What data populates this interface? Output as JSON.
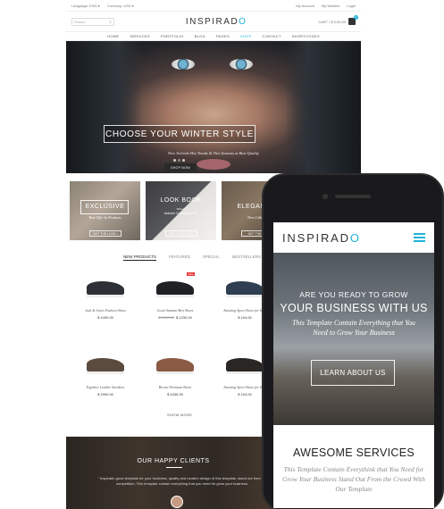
{
  "desktop": {
    "topbar": {
      "language": "Language: ENG ▾",
      "currency": "Currency: USD ▾",
      "my_account": "My Account",
      "wishlist": "My Wishlist",
      "login": "Login"
    },
    "header": {
      "search_placeholder": "Search",
      "logo_main": "INSPIRAD",
      "logo_o": "O",
      "cart_label": "CART / $ 0,00.00",
      "cart_count": "0"
    },
    "nav": [
      "HOME",
      "SERVICES",
      "PORTFOLIO",
      "BLOG",
      "PAGES",
      "SHOP",
      "CONTACT",
      "SHORTCODES"
    ],
    "nav_active": "SHOP",
    "hero": {
      "title": "CHOOSE YOUR WINTER STYLE",
      "subtitle": "New Arrivals Hot Trends & This Seasons at Best Quality",
      "button": "SHOP NOW"
    },
    "banners": [
      {
        "title": "EXCLUSIVE",
        "subtitle": "Best Offer In Products",
        "button": "GET THE LOOK ›"
      },
      {
        "title": "LOOK BOOK",
        "subtitle": "Woman",
        "extra": "Autumn Collection 2015",
        "button": "GET THE LOOK ›"
      },
      {
        "title": "ELEGANT C",
        "subtitle": "New Collecti",
        "button": "GET THE LO"
      }
    ],
    "tabs": [
      "NEW PRODUCTS",
      "FEATURED",
      "SPECIAL",
      "BESTSELLERS"
    ],
    "active_tab": "NEW PRODUCTS",
    "products": [
      {
        "name": "Jack & Jones Fashion Shoes",
        "price": "$ 1090.00",
        "old": "",
        "sale": "",
        "color": "#2d3036"
      },
      {
        "name": "Good Autumn Men Shoes",
        "price": "$ 1230.00",
        "old": "$ 2300.00",
        "sale": "Sale",
        "color": "#1f2125"
      },
      {
        "name": "Amazing Sport Shoes for Men",
        "price": "$ 104.00",
        "old": "",
        "sale": "",
        "color": "#2f3e52"
      },
      {
        "name": "Elegant Sport Sh",
        "price": "$ 1",
        "old": "",
        "sale": "",
        "color": "#5a4a3a"
      },
      {
        "name": "Together Leather Sneakers",
        "price": "$ 1990.00",
        "old": "",
        "sale": "",
        "color": "#5b4a3e"
      },
      {
        "name": "Brown Premium Shoes",
        "price": "$ 4435.00",
        "old": "",
        "sale": "",
        "color": "#8a5a44"
      },
      {
        "name": "Amazing Sport Shoes for Men",
        "price": "$ 104.00",
        "old": "",
        "sale": "",
        "color": "#2a2623"
      },
      {
        "name": "Elegant Sport",
        "price": "$ 4",
        "old": "",
        "sale": "",
        "color": "#4b4b4b"
      }
    ],
    "show_more": "SHOW MORE",
    "clients": {
      "title": "OUR HAPPY CLIENTS",
      "quote": "“ Inspirado good template for your business, quality and modern design of this template, stand out from the competition, This template contain everything that you need for grow your business."
    }
  },
  "mobile": {
    "logo_main": "INSPIRAD",
    "logo_o": "O",
    "hero": {
      "line1": "ARE YOU READY TO GROW",
      "line2": "YOUR BUSINESS WITH US",
      "line3": "This  Template Contain Everything that You Need to Grow Your Business",
      "button": "LEARN ABOUT US"
    },
    "services": {
      "title": "AWESOME SERVICES",
      "text": "This  Template Contain Everythink that You Need for Grow Your Business Stand Out From the Crowd With Our Template"
    }
  }
}
